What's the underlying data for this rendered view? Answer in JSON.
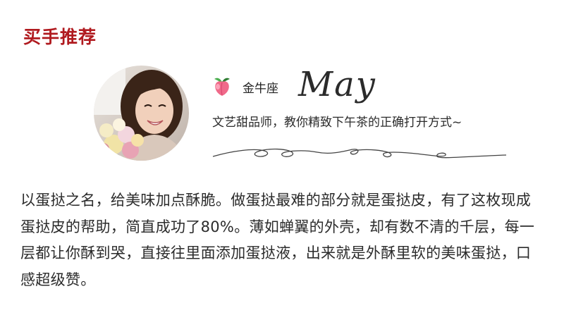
{
  "section": {
    "title": "买手推荐"
  },
  "author": {
    "zodiac": "金牛座",
    "name": "May",
    "tagline": "文艺甜品师，教你精致下午茶的正确打开方式~",
    "zodiac_icon": "peach-icon",
    "avatar": "photo of a smiling woman holding a bouquet of roses"
  },
  "description": "以蛋挞之名，给美味加点酥脆。做蛋挞最难的部分就是蛋挞皮，有了这枚现成蛋挞皮的帮助，简直成功了80%。薄如蝉翼的外壳，却有数不清的千层，每一层都让你酥到哭，直接往里面添加蛋挞液，出来就是外酥里软的美味蛋挞，口感超级赞。",
  "colors": {
    "accent": "#b01a1f",
    "text": "#2b2b2b",
    "peach": "#f06a8a"
  }
}
